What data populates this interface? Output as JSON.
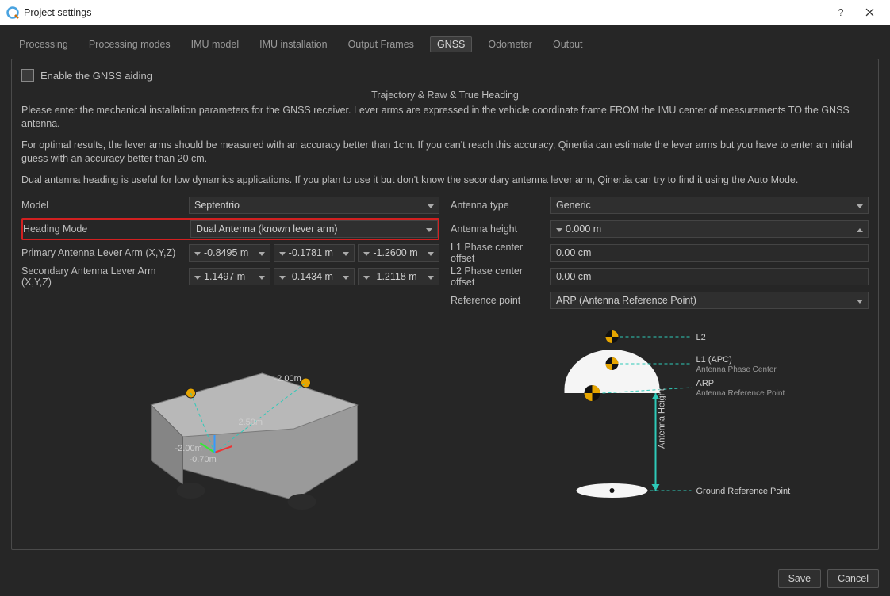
{
  "window": {
    "title": "Project settings"
  },
  "tabs": [
    "Processing",
    "Processing modes",
    "IMU model",
    "IMU installation",
    "Output Frames",
    "GNSS",
    "Odometer",
    "Output"
  ],
  "active_tab": "GNSS",
  "enable_label": "Enable the GNSS aiding",
  "section_title": "Trajectory & Raw & True Heading",
  "desc1": "Please enter the mechanical installation parameters for the GNSS receiver. Lever arms are expressed in the vehicle coordinate frame FROM the IMU center of measurements TO the GNSS antenna.",
  "desc2": "For optimal results, the lever arms should be measured with an accuracy better than 1cm. If you can't reach this accuracy, Qinertia can estimate the lever arms but you have to enter an initial guess with an accuracy better than 20 cm.",
  "desc3": "Dual antenna heading is useful for low dynamics applications. If you plan to use it but don't know the secondary antenna lever arm, Qinertia can try to find it using the Auto Mode.",
  "left": {
    "model_label": "Model",
    "model_value": "Septentrio",
    "heading_label": "Heading Mode",
    "heading_value": "Dual Antenna (known lever arm)",
    "primary_label": "Primary Antenna Lever Arm (X,Y,Z)",
    "primary": {
      "x": "-0.8495 m",
      "y": "-0.1781 m",
      "z": "-1.2600 m"
    },
    "secondary_label": "Secondary Antenna Lever Arm (X,Y,Z)",
    "secondary": {
      "x": "1.1497 m",
      "y": "-0.1434 m",
      "z": "-1.2118 m"
    }
  },
  "right": {
    "antenna_type_label": "Antenna type",
    "antenna_type_value": "Generic",
    "antenna_height_label": "Antenna height",
    "antenna_height_value": "0.000 m",
    "l1_label": "L1 Phase center offset",
    "l1_value": "0.00 cm",
    "l2_label": "L2 Phase center offset",
    "l2_value": "0.00 cm",
    "ref_label": "Reference point",
    "ref_value": "ARP (Antenna Reference Point)"
  },
  "antenna_diagram": {
    "l2": "L2",
    "l1": "L1 (APC)",
    "l1_sub": "Antenna Phase Center",
    "arp": "ARP",
    "arp_sub": "Antenna Reference Point",
    "height": "Antenna Height",
    "ground": "Ground Reference Point"
  },
  "vehicle_labels": {
    "a": "-2.00m",
    "b": "2.50m",
    "c": "-2.00m",
    "d": "-0.70m"
  },
  "buttons": {
    "save": "Save",
    "cancel": "Cancel"
  }
}
